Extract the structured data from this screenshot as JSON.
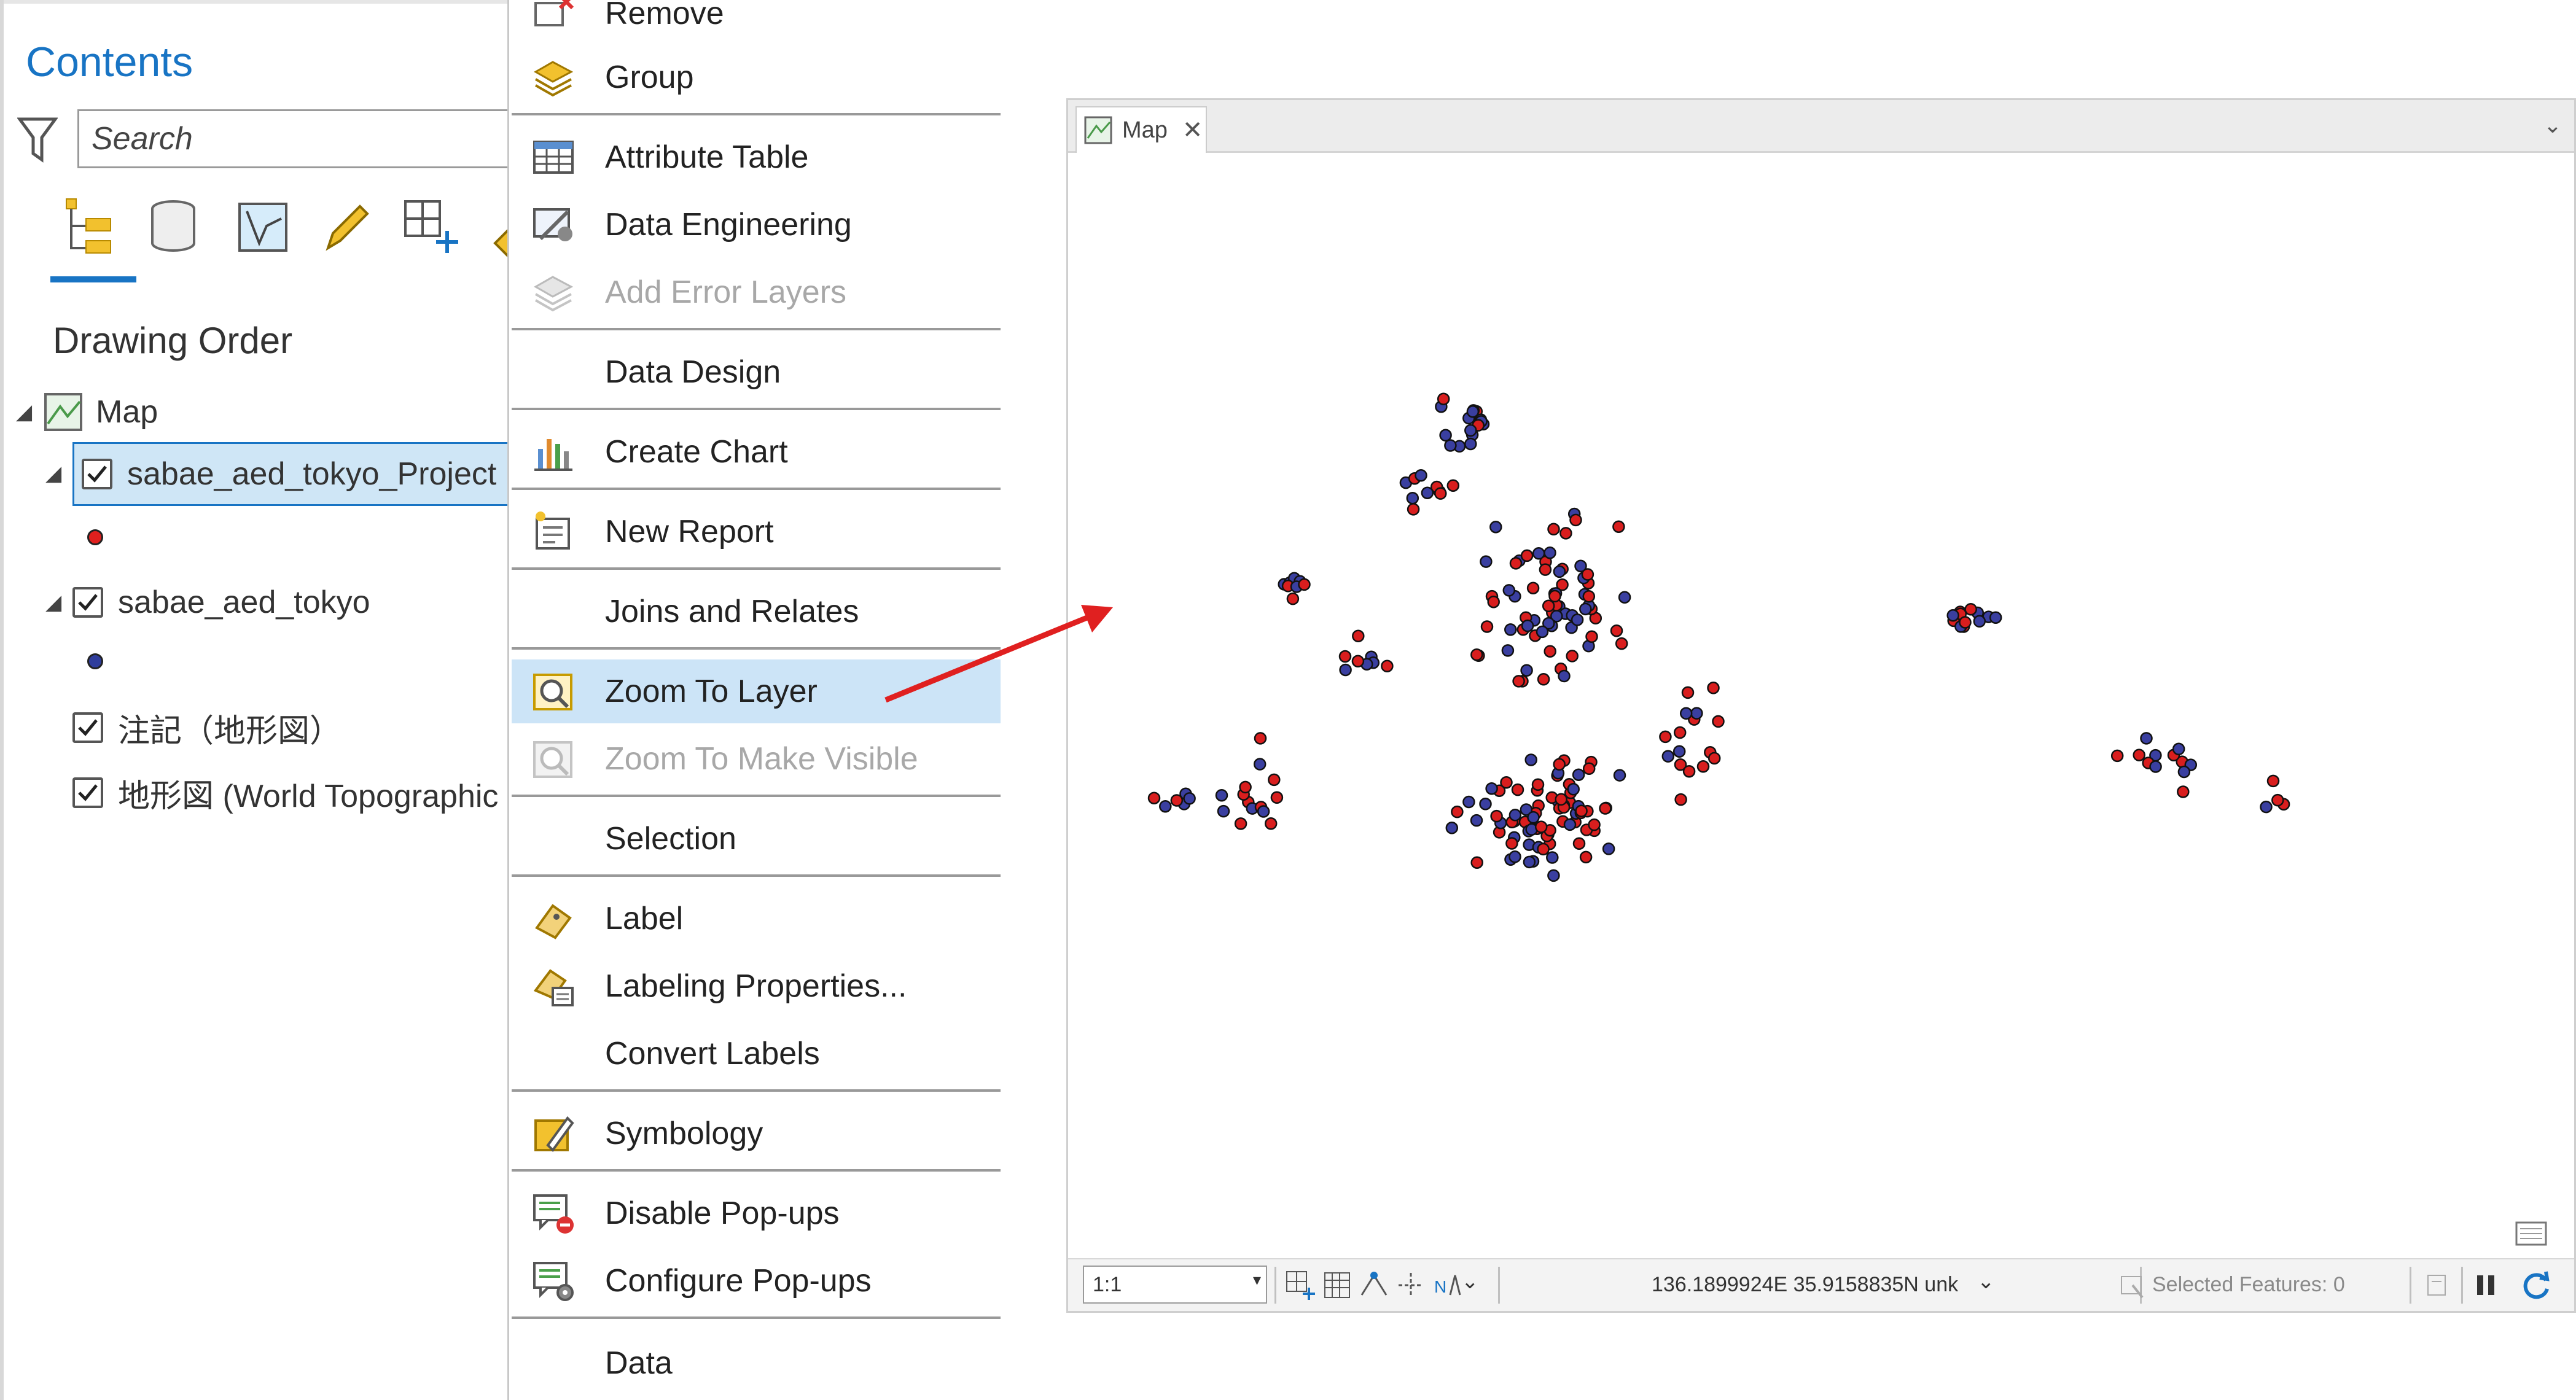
{
  "contents": {
    "title": "Contents",
    "search_placeholder": "Search",
    "drawing_order": "Drawing Order",
    "map_label": "Map",
    "layers": [
      {
        "name": "sabae_aed_tokyo_Project",
        "checked": true,
        "selected": true,
        "symbol_color": "#e0201e"
      },
      {
        "name": "sabae_aed_tokyo",
        "checked": true,
        "symbol_color": "#2f3d9c"
      },
      {
        "name": "注記（地形図）",
        "checked": true
      },
      {
        "name": "地形図 (World Topographic",
        "checked": true
      }
    ]
  },
  "menu": {
    "items": [
      {
        "label": "Remove",
        "icon": "remove-icon"
      },
      {
        "label": "Group",
        "icon": "group-layers-icon"
      },
      {
        "label": "Attribute Table",
        "icon": "attribute-table-icon"
      },
      {
        "label": "Data Engineering",
        "icon": "data-engineering-icon"
      },
      {
        "label": "Add Error Layers",
        "icon": "add-error-layers-icon",
        "disabled": true
      },
      {
        "label": "Data Design"
      },
      {
        "label": "Create Chart",
        "icon": "chart-icon"
      },
      {
        "label": "New Report",
        "icon": "report-icon"
      },
      {
        "label": "Joins and Relates"
      },
      {
        "label": "Zoom To Layer",
        "icon": "zoom-to-layer-icon",
        "highlighted": true
      },
      {
        "label": "Zoom To Make Visible",
        "icon": "zoom-visible-icon",
        "disabled": true
      },
      {
        "label": "Selection"
      },
      {
        "label": "Label",
        "icon": "label-icon"
      },
      {
        "label": "Labeling Properties...",
        "icon": "labeling-properties-icon"
      },
      {
        "label": "Convert Labels"
      },
      {
        "label": "Symbology",
        "icon": "symbology-icon"
      },
      {
        "label": "Disable Pop-ups",
        "icon": "disable-popups-icon"
      },
      {
        "label": "Configure Pop-ups",
        "icon": "configure-popups-icon"
      },
      {
        "label": "Data"
      }
    ]
  },
  "map": {
    "tab_label": "Map",
    "scale": "1:1",
    "coordinates": "136.1899924E 35.9158835N unk",
    "selected_features": "Selected Features: 0",
    "colors": {
      "red": "#d91e1e",
      "blue": "#3a3fa0",
      "accent": "#1874c4"
    }
  }
}
